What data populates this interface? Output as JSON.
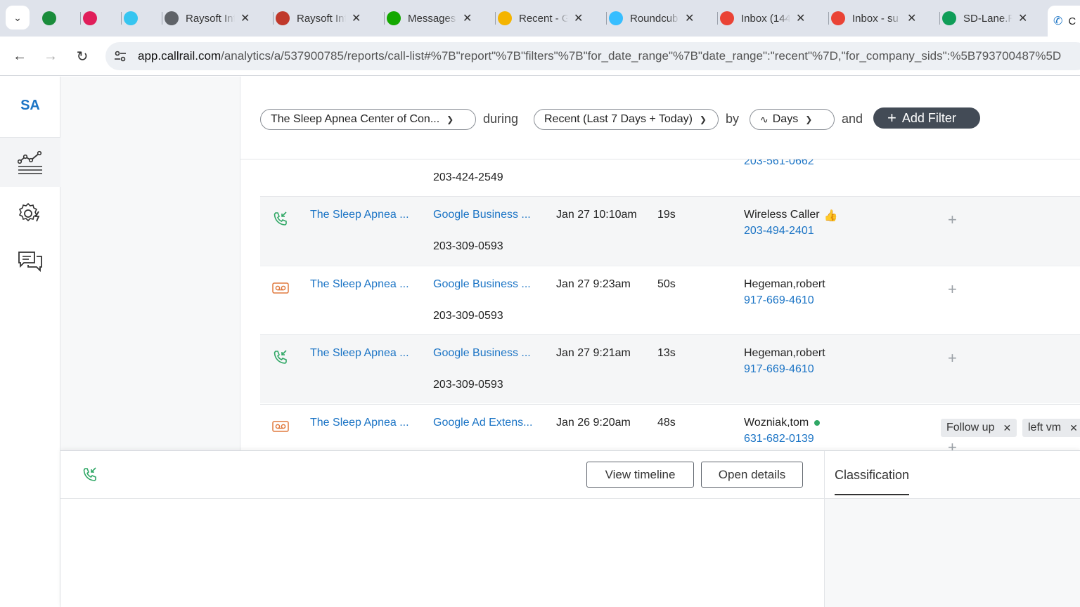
{
  "browser": {
    "tabs": [
      {
        "title": "",
        "icon": "onepassword-icon",
        "color": "#1a8c3b"
      },
      {
        "title": "",
        "icon": "slack-icon",
        "color": "#e01e5a"
      },
      {
        "title": "",
        "icon": "slack-icon",
        "color": "#36c5f0"
      },
      {
        "title": "Raysoft Inf",
        "icon": "globe-icon",
        "color": "#5f6368"
      },
      {
        "title": "Raysoft Inf",
        "icon": "raysoft-icon",
        "color": "#c0392b"
      },
      {
        "title": "Messages",
        "icon": "upwork-icon",
        "color": "#14a800"
      },
      {
        "title": "Recent - G",
        "icon": "google-drive-icon",
        "color": "#f4b400"
      },
      {
        "title": "Roundcub",
        "icon": "roundcube-icon",
        "color": "#37beff"
      },
      {
        "title": "Inbox (144",
        "icon": "gmail-icon",
        "color": "#ea4335"
      },
      {
        "title": "Inbox - su",
        "icon": "gmail-icon",
        "color": "#ea4335"
      },
      {
        "title": "SD-Lane.R",
        "icon": "sheets-icon",
        "color": "#0f9d58"
      }
    ],
    "active_tab_title": "C",
    "url_host": "app.callrail.com",
    "url_path": "/analytics/a/537900785/reports/call-list#%7B\"report\"%7B\"filters\"%7B\"for_date_range\"%7B\"date_range\":\"recent\"%7D,\"for_company_sids\":%5B793700487%5D"
  },
  "nav": {
    "logo": "SA"
  },
  "filters": {
    "company": "The Sleep Apnea Center of Con...",
    "during": "during",
    "date_range": "Recent (Last 7 Days + Today)",
    "by": "by",
    "interval": "Days",
    "and": "and",
    "add_filter": "Add Filter"
  },
  "calls": {
    "partial_row": {
      "tracking": "203-424-2549",
      "caller_number": "203-561-0662"
    },
    "rows": [
      {
        "type": "inbound",
        "company": "The Sleep Apnea ...",
        "source": "Google Business ...",
        "tracking": "203-309-0593",
        "time": "Jan 27 10:10am",
        "duration": "19s",
        "caller": "Wireless Caller",
        "caller_number": "203-494-2401",
        "tags": []
      },
      {
        "type": "voicemail",
        "company": "The Sleep Apnea ...",
        "source": "Google Business ...",
        "tracking": "203-309-0593",
        "time": "Jan 27 9:23am",
        "duration": "50s",
        "caller": "Hegeman,robert",
        "caller_number": "917-669-4610",
        "tags": []
      },
      {
        "type": "inbound",
        "company": "The Sleep Apnea ...",
        "source": "Google Business ...",
        "tracking": "203-309-0593",
        "time": "Jan 27 9:21am",
        "duration": "13s",
        "caller": "Hegeman,robert",
        "caller_number": "917-669-4610",
        "tags": []
      },
      {
        "type": "voicemail",
        "company": "The Sleep Apnea ...",
        "source": "Google Ad Extens...",
        "tracking": "",
        "time": "Jan 26 9:20am",
        "duration": "48s",
        "caller": "Wozniak,tom",
        "caller_number": "631-682-0139",
        "tags": [
          "Follow up",
          "left vm"
        ]
      }
    ]
  },
  "detail": {
    "view_timeline": "View timeline",
    "open_details": "Open details",
    "classification_tab": "Classification"
  },
  "colors": {
    "link": "#1b74c5",
    "inbound_icon": "#2fa765",
    "voicemail_icon": "#e07a3f",
    "add_filter_bg": "#434b56"
  }
}
